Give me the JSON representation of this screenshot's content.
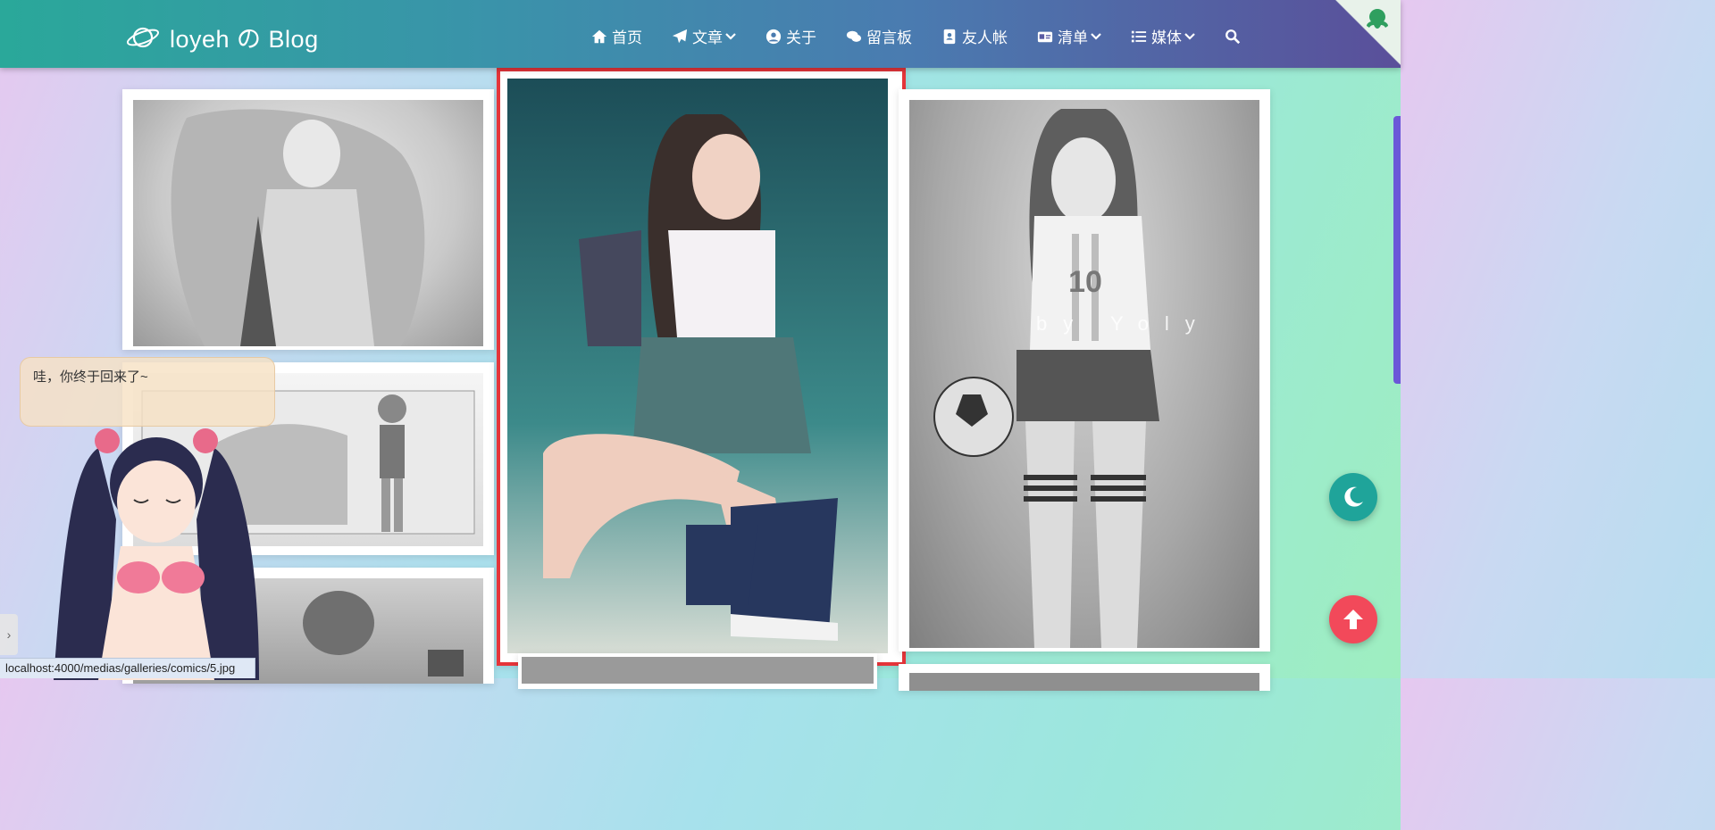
{
  "header": {
    "brand": "loyeh の Blog",
    "nav": [
      {
        "label": "首页",
        "icon": "home-icon",
        "dropdown": false
      },
      {
        "label": "文章",
        "icon": "paper-plane-icon",
        "dropdown": true
      },
      {
        "label": "关于",
        "icon": "user-circle-icon",
        "dropdown": false
      },
      {
        "label": "留言板",
        "icon": "comments-icon",
        "dropdown": false
      },
      {
        "label": "友人帐",
        "icon": "address-book-icon",
        "dropdown": false
      },
      {
        "label": "清单",
        "icon": "id-card-icon",
        "dropdown": true
      },
      {
        "label": "媒体",
        "icon": "list-icon",
        "dropdown": true
      }
    ]
  },
  "gallery": {
    "watermark": "by Yoly",
    "selected_highlight_color": "#e5353a"
  },
  "mascot": {
    "message": "哇，你终于回来了~"
  },
  "status_url": "localhost:4000/medias/galleries/comics/5.jpg",
  "colors": {
    "moon_button": "#1fa49a",
    "top_button": "#f2495a"
  }
}
